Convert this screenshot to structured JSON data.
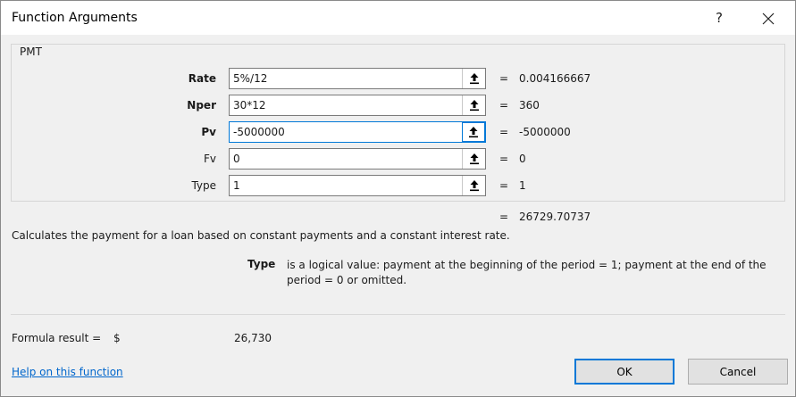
{
  "window": {
    "title": "Function Arguments",
    "help_glyph": "?",
    "close_icon": "close-icon"
  },
  "function_name": "PMT",
  "arguments": [
    {
      "name": "Rate",
      "value": "5%/12",
      "result": "0.004166667",
      "bold": true
    },
    {
      "name": "Nper",
      "value": "30*12",
      "result": "360",
      "bold": true
    },
    {
      "name": "Pv",
      "value": "-5000000",
      "result": "-5000000",
      "bold": true
    },
    {
      "name": "Fv",
      "value": "0",
      "result": "0",
      "bold": false
    },
    {
      "name": "Type",
      "value": "1",
      "result": "1",
      "bold": false
    }
  ],
  "equals_sign": "=",
  "function_result": "26729.70737",
  "description": "Calculates the payment for a loan based on constant payments and a constant interest rate.",
  "argument_help": {
    "name": "Type",
    "text": "is a logical value: payment at the beginning of the period = 1; payment at the end of the period = 0 or omitted."
  },
  "formula_result": {
    "label": "Formula result =",
    "currency": "$",
    "value": "26,730"
  },
  "help_link": "Help on this function",
  "buttons": {
    "ok": "OK",
    "cancel": "Cancel"
  },
  "colors": {
    "accent": "#0078d7",
    "link": "#0066cc"
  }
}
